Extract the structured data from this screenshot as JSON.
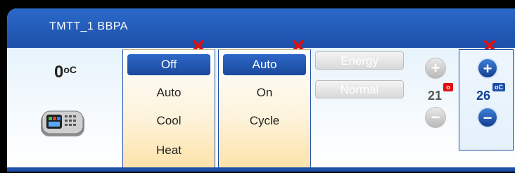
{
  "window": {
    "title": "TMTT_1 BBPA"
  },
  "room": {
    "temperature": "0",
    "unit": "oC"
  },
  "mode_menu": {
    "options": [
      "Off",
      "Auto",
      "Cool",
      "Heat"
    ],
    "selected": "Off"
  },
  "fan_menu": {
    "options": [
      "Auto",
      "On",
      "Cycle"
    ],
    "selected": "Auto"
  },
  "buttons": {
    "energy": "Energy",
    "normal": "Normal"
  },
  "heat_setpoint": {
    "value": "21",
    "badge": "o"
  },
  "cool_setpoint": {
    "value": "26",
    "badge": "oC"
  },
  "colors": {
    "accent": "#1c4fa8",
    "close": "#e01010",
    "heat_badge": "#e01010",
    "cool_badge": "#1c4fa8"
  },
  "icons": [
    "close-icon",
    "thermostat-device-icon",
    "plus-icon",
    "minus-icon"
  ]
}
